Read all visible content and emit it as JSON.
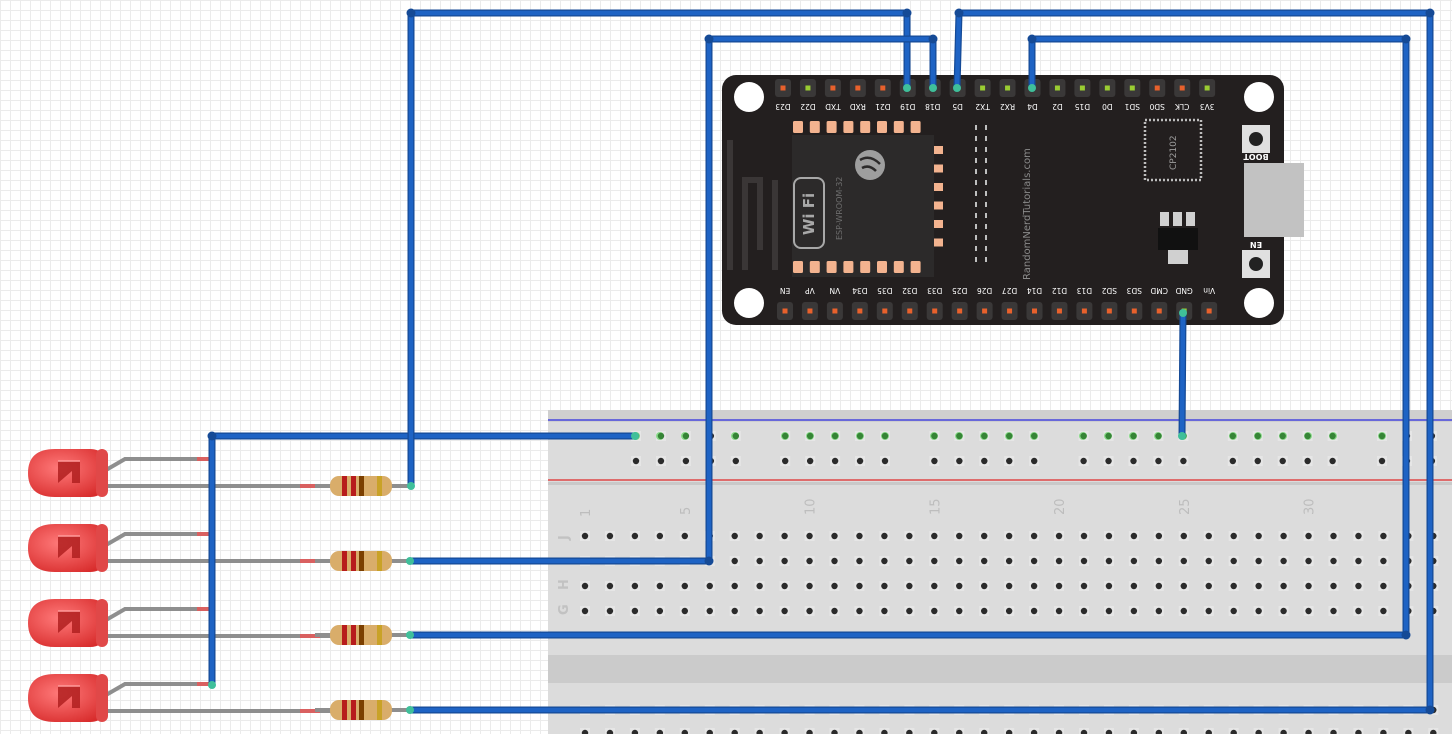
{
  "esp32": {
    "top_pins": [
      "D23",
      "D22",
      "TXD",
      "RXD",
      "D21",
      "D19",
      "D18",
      "D5",
      "TX2",
      "RX2",
      "D4",
      "D2",
      "D15",
      "D0",
      "SD1",
      "SD0",
      "CLK",
      "3V3"
    ],
    "bottom_pins": [
      "EN",
      "VP",
      "VN",
      "D34",
      "D35",
      "D32",
      "D33",
      "D25",
      "D26",
      "D27",
      "D14",
      "D12",
      "D13",
      "SD2",
      "SD3",
      "CMD",
      "GND",
      "Vin"
    ],
    "module_label": "ESP-WROOM-32",
    "wifi_badge": "Wi Fi",
    "chip_label": "CP2102",
    "boot_label": "BOOT",
    "en_label": "EN",
    "site_credit": "RandomNerdTutorials.com"
  },
  "breadboard": {
    "column_numbers": [
      "1",
      "5",
      "10",
      "15",
      "20",
      "25",
      "30"
    ],
    "row_letters": [
      "J",
      "H",
      "G"
    ]
  },
  "leds": {
    "count": 4,
    "color": "#e53935"
  },
  "resistors": {
    "count": 4
  },
  "wire_color": "#1e63c4"
}
